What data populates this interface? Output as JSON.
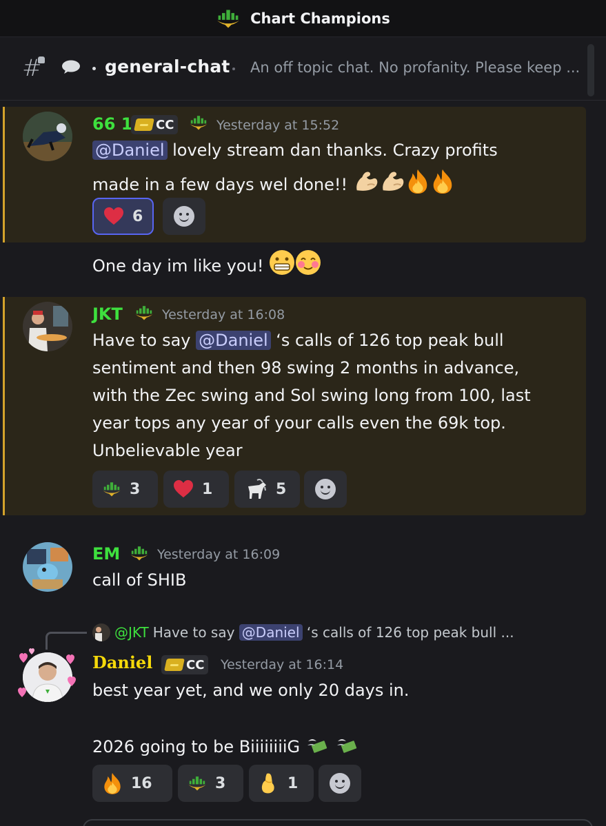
{
  "server": {
    "name": "Chart Champions"
  },
  "channel": {
    "name": "general-chat",
    "topic": "An off topic chat. No profanity. Please keep ..."
  },
  "messages": [
    {
      "author": "66 1",
      "author_color": "#3ee03e",
      "tag": "CC",
      "timestamp": "Yesterday at 15:52",
      "lines": [
        {
          "mention": "@Daniel",
          "text": " lovely stream dan thanks. Crazy profits"
        },
        {
          "text": "made in a few days wel done!!"
        }
      ],
      "reactions": [
        {
          "emoji": "heart",
          "count": "6",
          "active": true
        }
      ],
      "followup": "One day im like you!"
    },
    {
      "author": "JKT",
      "author_color": "#3ee03e",
      "timestamp": "Yesterday at 16:08",
      "lines": [
        {
          "pre": "Have to say ",
          "mention": "@Daniel",
          "text": " ‘s calls of 126 top peak bull"
        },
        {
          "text": "sentiment and then 98 swing 2 months in advance,"
        },
        {
          "text": "with the Zec swing and Sol swing long from 100, last"
        },
        {
          "text": "year tops any year of your calls even the 69k top."
        },
        {
          "text": "Unbelievable year"
        }
      ],
      "reactions": [
        {
          "emoji": "chart-champions-logo",
          "count": "3"
        },
        {
          "emoji": "heart",
          "count": "1"
        },
        {
          "emoji": "goat",
          "count": "5"
        }
      ]
    },
    {
      "author": "EM",
      "author_color": "#3ee03e",
      "timestamp": "Yesterday at 16:09",
      "lines": [
        {
          "text": "call of SHIB"
        }
      ]
    },
    {
      "reply": {
        "author": "@JKT",
        "pre": "Have to say ",
        "mention": "@Daniel",
        "text": " ‘s calls of 126 top peak bull ..."
      },
      "author": "Daniel",
      "author_color": "#f5d90a",
      "tag": "CC",
      "timestamp": "Yesterday at 16:14",
      "lines": [
        {
          "text": "best year yet, and we only 20 days in."
        },
        {
          "text": "2026 going to be BiiiiiiiiG"
        }
      ],
      "reactions": [
        {
          "emoji": "fire",
          "count": "16"
        },
        {
          "emoji": "chart-champions-logo",
          "count": "3"
        },
        {
          "emoji": "pinched-fingers",
          "count": "1"
        }
      ]
    }
  ],
  "colors": {
    "accent": "#5865f2",
    "highlight_border": "#d4a32b",
    "highlight_bg": "#2b2619",
    "mention_bg": "#3c4270"
  }
}
